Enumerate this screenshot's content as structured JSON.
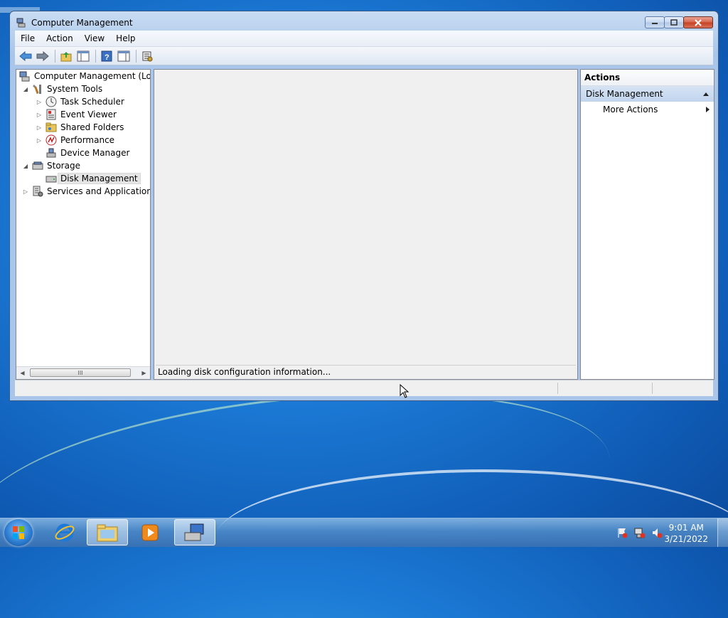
{
  "window": {
    "title": "Computer Management",
    "menu": [
      "File",
      "Action",
      "View",
      "Help"
    ]
  },
  "tree": {
    "items": [
      {
        "label": "Computer Management (Local",
        "icon": "computer-management-icon",
        "expander": ""
      },
      {
        "label": "System Tools",
        "icon": "system-tools-icon",
        "expander": "expanded"
      },
      {
        "label": "Task Scheduler",
        "icon": "task-scheduler-icon",
        "expander": "collapsed"
      },
      {
        "label": "Event Viewer",
        "icon": "event-viewer-icon",
        "expander": "collapsed"
      },
      {
        "label": "Shared Folders",
        "icon": "shared-folders-icon",
        "expander": "collapsed"
      },
      {
        "label": "Performance",
        "icon": "performance-icon",
        "expander": "collapsed"
      },
      {
        "label": "Device Manager",
        "icon": "device-manager-icon",
        "expander": ""
      },
      {
        "label": "Storage",
        "icon": "storage-icon",
        "expander": "expanded"
      },
      {
        "label": "Disk Management",
        "icon": "disk-management-icon",
        "expander": "",
        "selected": true
      },
      {
        "label": "Services and Applications",
        "icon": "services-applications-icon",
        "expander": "collapsed"
      }
    ],
    "scroll_thumb_glyph": "III"
  },
  "center": {
    "status_text": "Loading disk configuration information..."
  },
  "actions": {
    "header": "Actions",
    "group": "Disk Management",
    "items": [
      "More Actions"
    ]
  },
  "taskbar": {
    "time": "9:01 AM",
    "date": "3/21/2022"
  },
  "colors": {
    "desktop": "#1b79d4",
    "selection": "#e5e5e5",
    "actions_group_bg": "#c2d5ee"
  }
}
